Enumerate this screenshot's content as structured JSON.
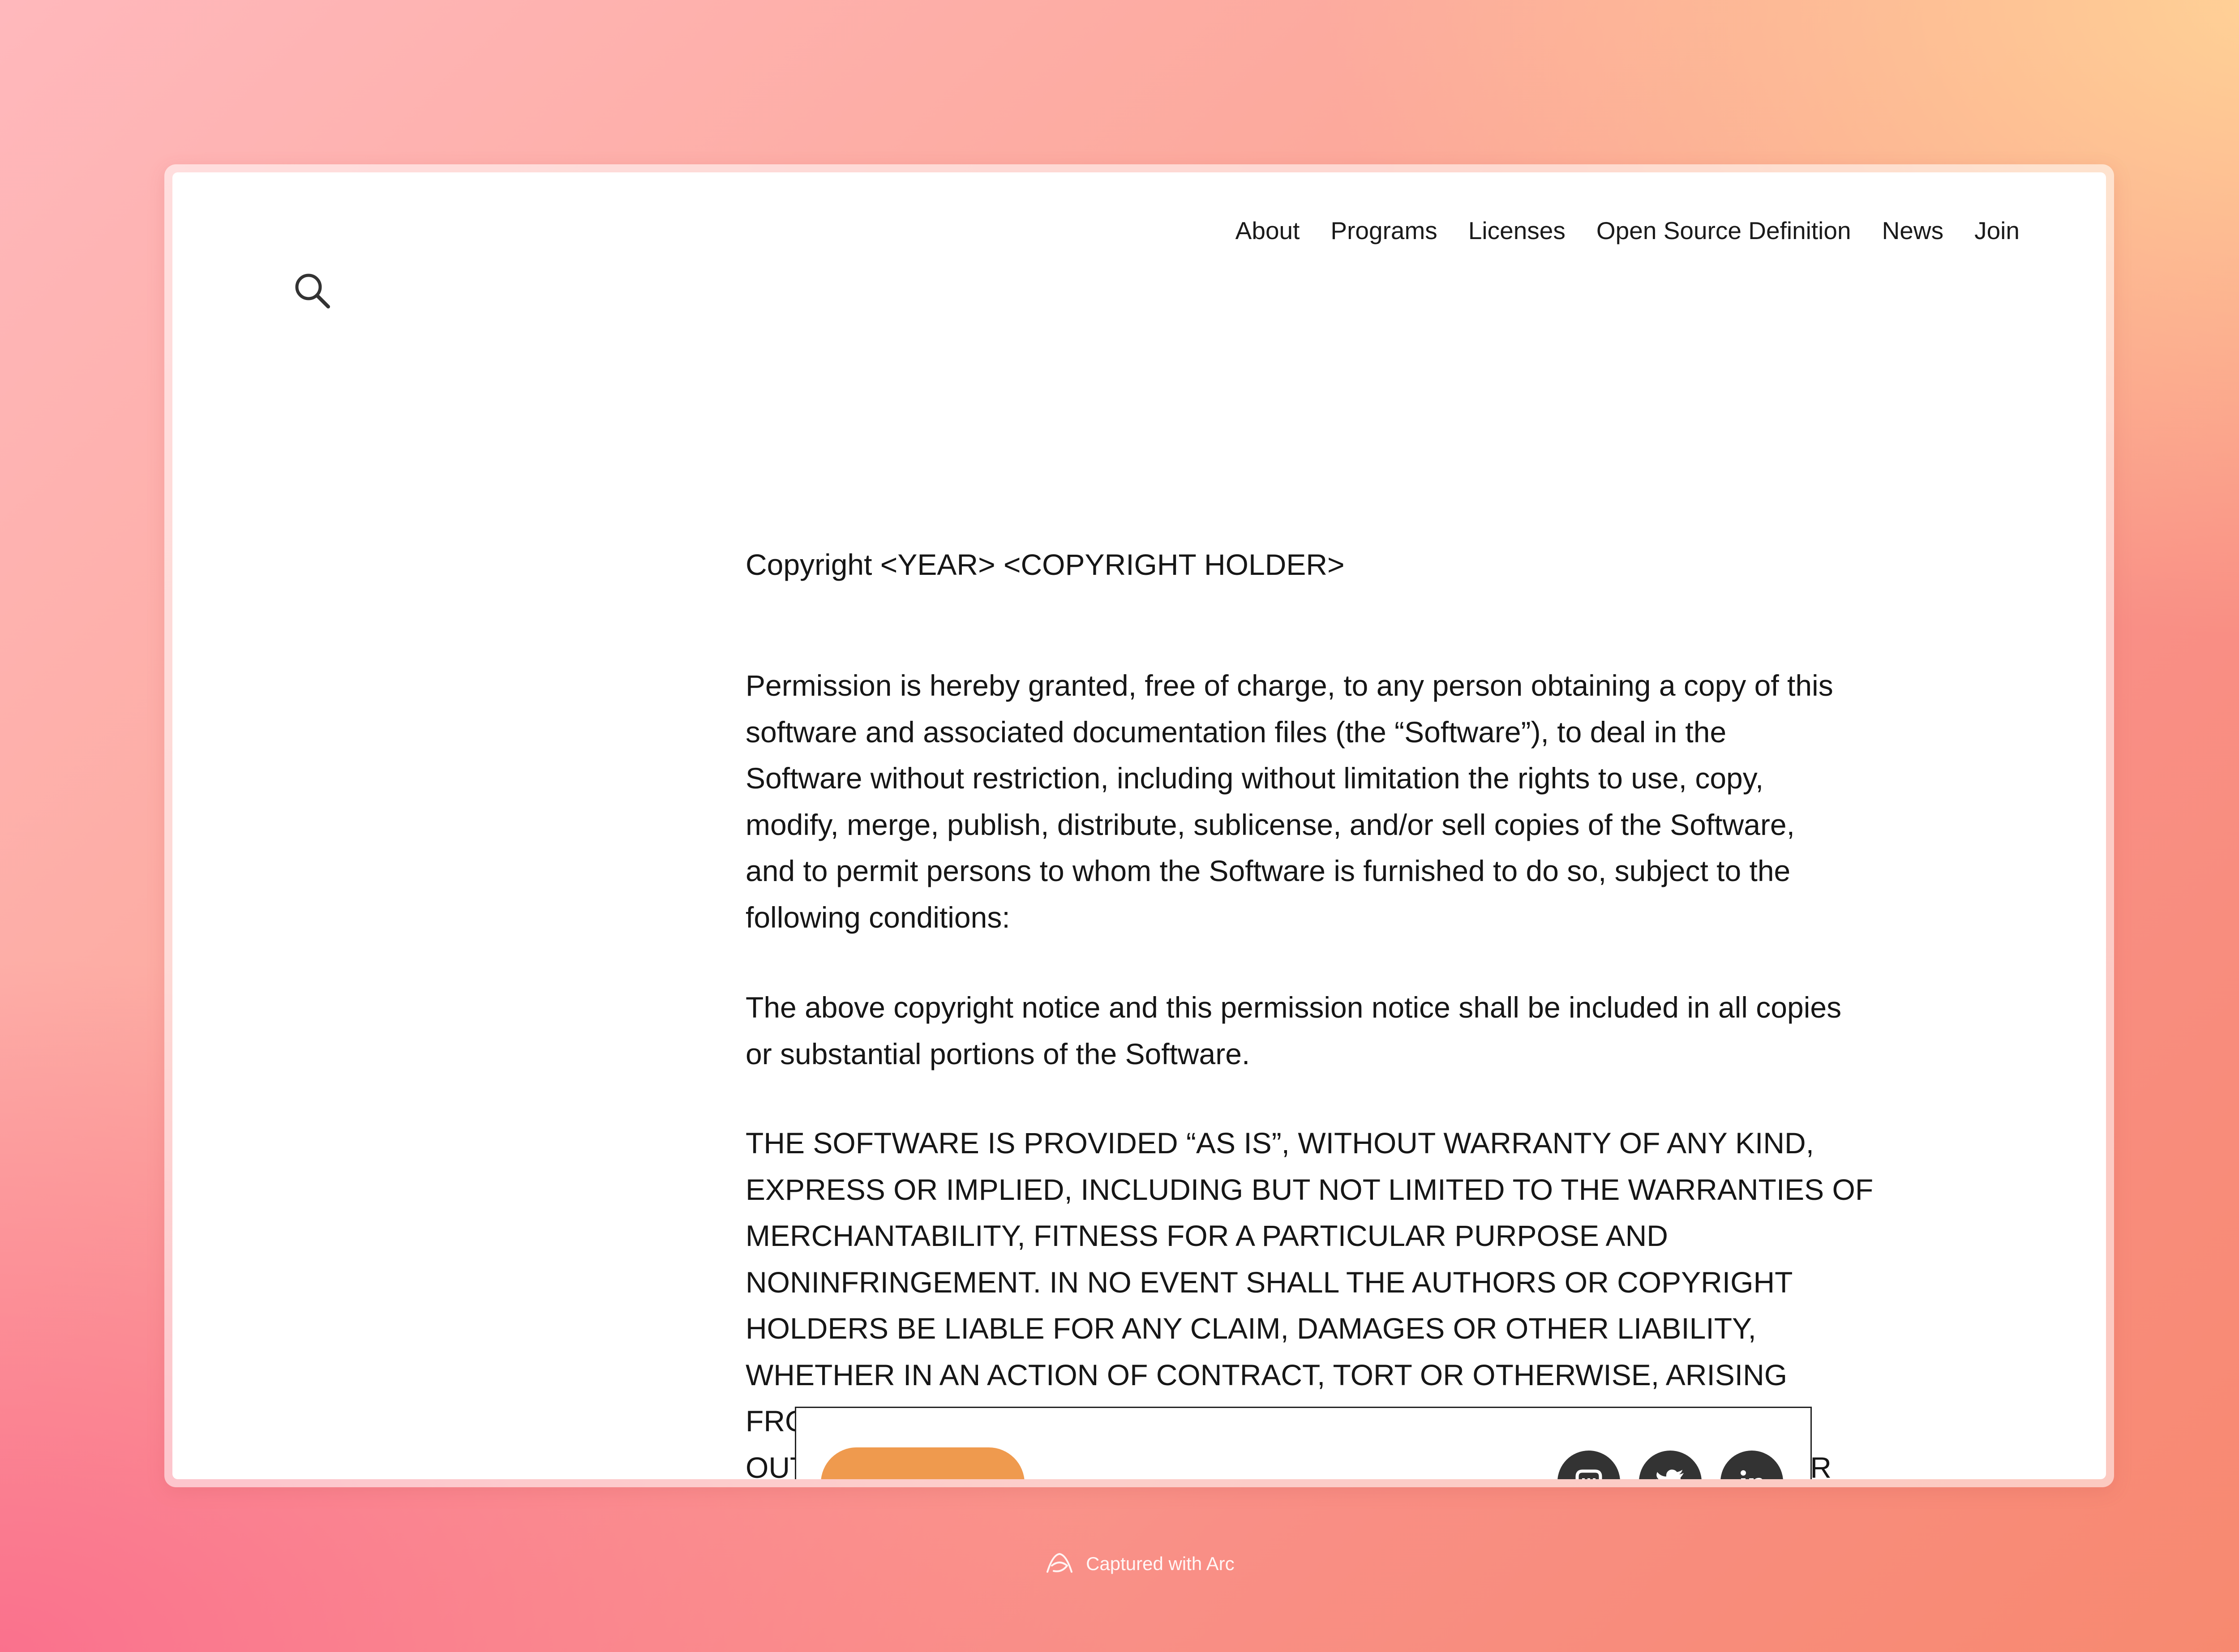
{
  "nav": {
    "items": [
      {
        "label": "About"
      },
      {
        "label": "Programs"
      },
      {
        "label": "Licenses"
      },
      {
        "label": "Open Source Definition"
      },
      {
        "label": "News"
      },
      {
        "label": "Join"
      }
    ]
  },
  "search": {
    "icon": "search-icon"
  },
  "license": {
    "copyright_line": "Copyright <YEAR> <COPYRIGHT HOLDER>",
    "permission_text": "Permission is hereby granted, free of charge, to any person obtaining a copy of this\nsoftware and associated documentation files (the “Software”), to deal in the\nSoftware without restriction, including without limitation the rights to use, copy,\nmodify, merge, publish, distribute, sublicense, and/or sell copies of the Software,\nand to permit persons to whom the Software is furnished to do so, subject to the\nfollowing conditions:",
    "notice_text": "The above copyright notice and this permission notice shall be included in all copies\nor substantial portions of the Software.",
    "warranty_text": "THE SOFTWARE IS PROVIDED “AS IS”, WITHOUT WARRANTY OF ANY KIND,\nEXPRESS OR IMPLIED, INCLUDING BUT NOT LIMITED TO THE WARRANTIES OF\nMERCHANTABILITY, FITNESS FOR A PARTICULAR PURPOSE AND\nNONINFRINGEMENT. IN NO EVENT SHALL THE AUTHORS OR COPYRIGHT\nHOLDERS BE LIABLE FOR ANY CLAIM, DAMAGES OR OTHER LIABILITY,\nWHETHER IN AN ACTION OF CONTRACT, TORT OR OTHERWISE, ARISING FROM,\nOUT OF OR IN CONNECTION WITH THE SOFTWARE OR THE USE OR OTHER\nDEALINGS IN THE SOFTWARE."
  },
  "footer": {
    "social_icons": [
      "mastodon-icon",
      "twitter-icon",
      "linkedin-icon"
    ]
  },
  "watermark": {
    "label": "Captured with Arc",
    "icon": "arc-logo-icon"
  },
  "colors": {
    "button_accent": "#ef9a4e",
    "social_icon_bg": "#333333",
    "text": "#161616"
  }
}
